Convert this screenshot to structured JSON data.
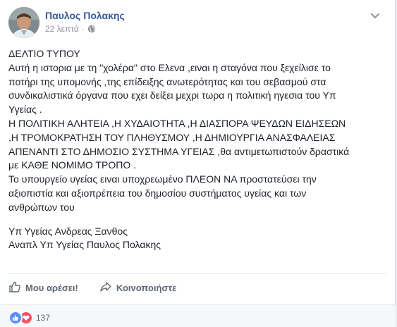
{
  "post": {
    "author": "Παυλος Πολακης",
    "time": "22 λεπτά",
    "privacy_icon": "globe-icon",
    "options_icon": "chevron-down-icon"
  },
  "body": {
    "lines": [
      "ΔΕΛΤΙΟ ΤΥΠΟΥ",
      "Αυτή η ιστορια με τη \"χολέρα\" στο Ελενα ,ειναι η σταγόνα που ξεχείλισε το",
      "ποτήρι της υπομονής ,της επίδειξης ανωτερότητας και του σεβασμού στα",
      "συνδικαλιστικά όργανα που εχει δείξει μεχρι τωρα η πολιτική ηγεσια του Υπ",
      "Υγείας .",
      "Η ΠΟΛΙΤΙΚΗ ΑΛΗΤΕΙΑ ,Η ΧΥΔΑΙΟΤΗΤΑ ,Η ΔΙΑΣΠΟΡΑ ΨΕΥΔΩΝ ΕΙΔΗΣΕΩΝ",
      ",Η ΤΡΟΜΟΚΡΑΤΗΣΗ ΤΟΥ ΠΛΗΘΥΣΜΟΥ ,Η ΔΗΜΙΟΥΡΓΙΑ ΑΝΑΣΦΑΛΕΙΑΣ",
      "ΑΠΕΝΑΝΤΙ ΣΤΟ ΔΗΜΟΣΙΟ ΣΥΣΤΗΜΑ ΥΓΕΙΑΣ ,θα αντιμετωπιστούν δραστικά",
      "με ΚΑΘΕ ΝΟΜΙΜΟ ΤΡΟΠΟ .",
      "Το υπουργείο υγείας ειναι υποχρεωμένο ΠΛΕΟΝ ΝΑ προστατεύσει την",
      "αξιοπιστία και αξιοπρέπεια του δημοσίου συστήματος υγείας και των",
      "ανθρώπων του"
    ],
    "signature": [
      "Υπ Υγείας Ανδρεας Ξανθος",
      "Αναπλ Υπ Υγείας Παυλος Πολακης"
    ]
  },
  "actions": {
    "like_label": "Μου αρέσει!",
    "like_icon": "thumbs-up-icon",
    "share_label": "Κοινοποιήστε",
    "share_icon": "share-arrow-icon"
  },
  "reactions": {
    "count": "137",
    "icons": [
      "like-reaction-icon",
      "love-reaction-icon"
    ]
  },
  "colors": {
    "link": "#365899",
    "meta": "#90949c",
    "action": "#606770",
    "like_blue": "#5890ff",
    "love_red": "#f25268"
  }
}
